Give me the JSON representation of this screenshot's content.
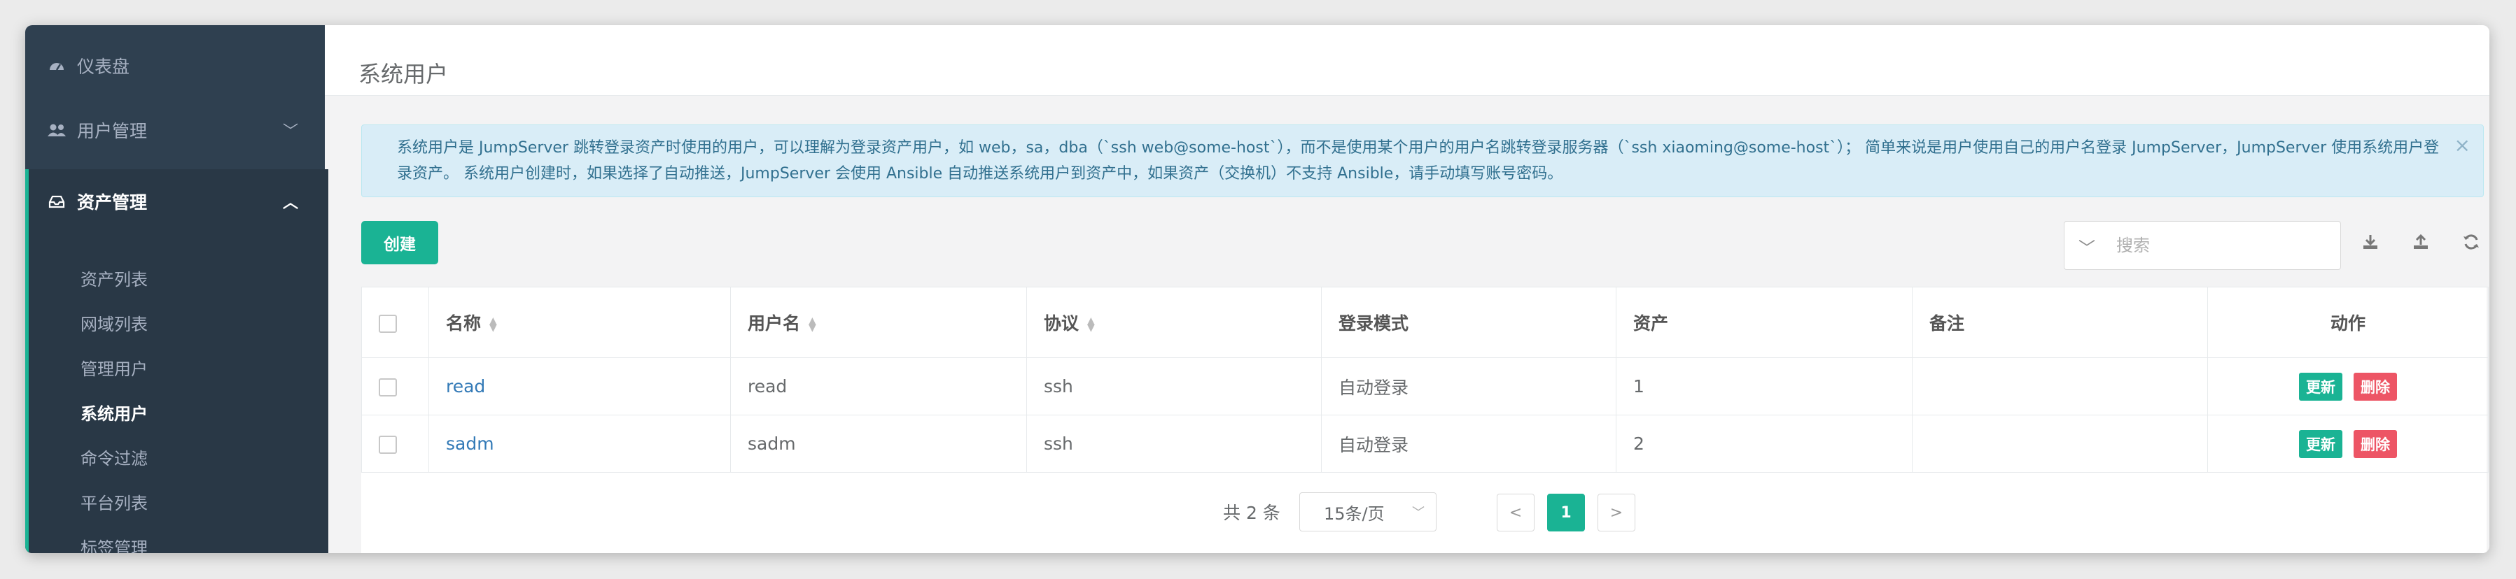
{
  "sidebar": {
    "dashboard": {
      "label": "仪表盘",
      "icon": "dashboard-icon"
    },
    "users": {
      "label": "用户管理",
      "icon": "users-icon"
    },
    "assets": {
      "label": "资产管理",
      "icon": "inbox-icon",
      "items": [
        {
          "label": "资产列表"
        },
        {
          "label": "网域列表"
        },
        {
          "label": "管理用户"
        },
        {
          "label": "系统用户"
        },
        {
          "label": "命令过滤"
        },
        {
          "label": "平台列表"
        },
        {
          "label": "标签管理"
        }
      ],
      "active_item": "系统用户"
    }
  },
  "header": {
    "title": "系统用户"
  },
  "alert": {
    "text": "系统用户是 JumpServer 跳转登录资产时使用的用户，可以理解为登录资产用户，如 web，sa，dba（`ssh web@some-host`），而不是使用某个用户的用户名跳转登录服务器（`ssh xiaoming@some-host`）； 简单来说是用户使用自己的用户名登录 JumpServer，JumpServer 使用系统用户登录资产。 系统用户创建时，如果选择了自动推送，JumpServer 会使用 Ansible 自动推送系统用户到资产中，如果资产（交换机）不支持 Ansible，请手动填写账号密码。",
    "close": "×"
  },
  "toolbar": {
    "create_label": "创建",
    "search_placeholder": "搜索"
  },
  "table": {
    "columns": [
      "名称",
      "用户名",
      "协议",
      "登录模式",
      "资产",
      "备注",
      "动作"
    ],
    "rows": [
      {
        "name": "read",
        "username": "read",
        "protocol": "ssh",
        "login_mode": "自动登录",
        "assets": "1",
        "comment": ""
      },
      {
        "name": "sadm",
        "username": "sadm",
        "protocol": "ssh",
        "login_mode": "自动登录",
        "assets": "2",
        "comment": ""
      }
    ],
    "update_label": "更新",
    "delete_label": "删除"
  },
  "pagination": {
    "total": "共 2 条",
    "page_size": "15条/页",
    "current_page": "1",
    "prev": "<",
    "next": ">"
  },
  "colors": {
    "accent": "#1ab394",
    "danger": "#ed5565",
    "sidebar": "#2f4050",
    "link": "#337ab7"
  }
}
